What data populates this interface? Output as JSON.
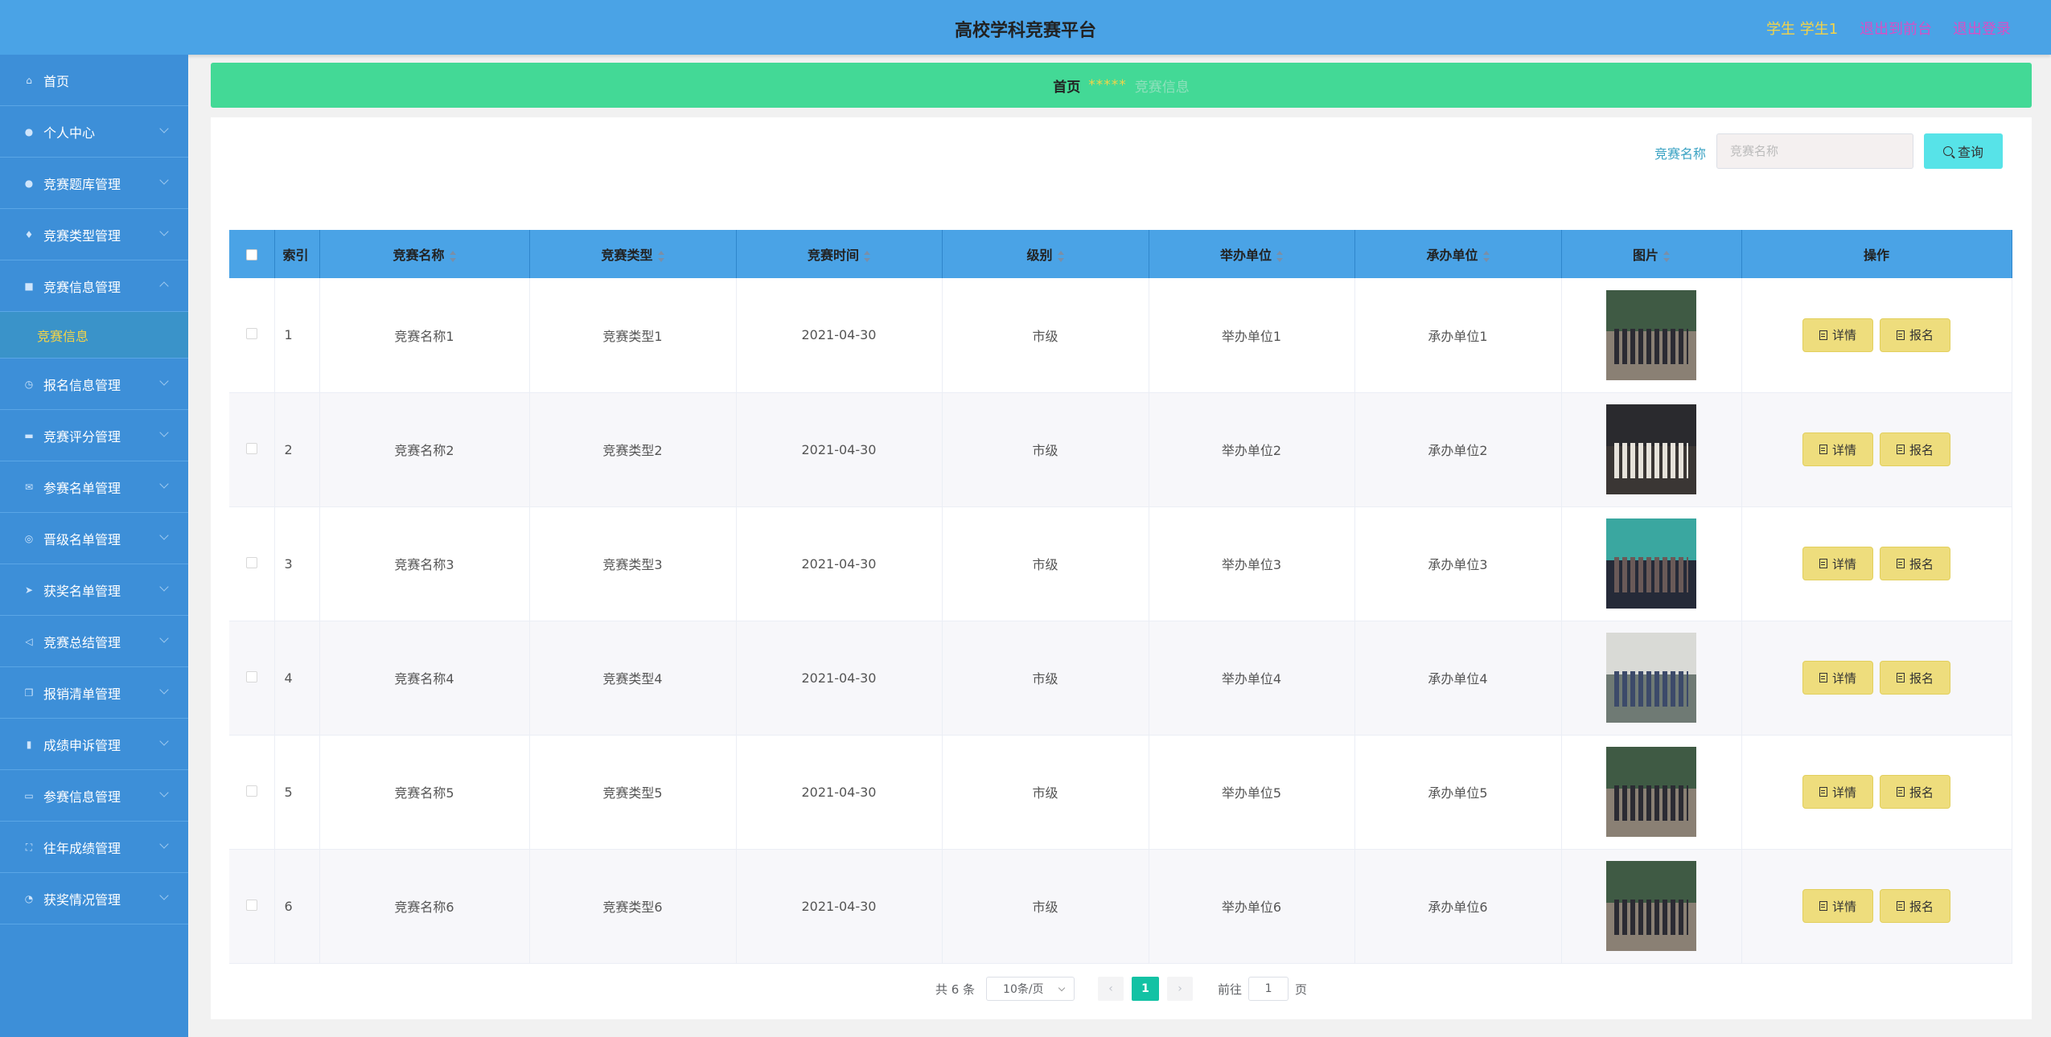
{
  "header": {
    "title": "高校学科竞赛平台",
    "user": "学生 学生1",
    "front_link": "退出到前台",
    "logout_link": "退出登录"
  },
  "sidebar": {
    "items": [
      {
        "label": "首页",
        "icon": "home-icon"
      },
      {
        "label": "个人中心",
        "icon": "user-icon"
      },
      {
        "label": "竞赛题库管理",
        "icon": "user-icon"
      },
      {
        "label": "竞赛类型管理",
        "icon": "microphone-icon"
      },
      {
        "label": "竞赛信息管理",
        "icon": "clipboard-icon",
        "expanded": true,
        "sub": "竞赛信息"
      },
      {
        "label": "报名信息管理",
        "icon": "clock-icon"
      },
      {
        "label": "竞赛评分管理",
        "icon": "monitor-icon"
      },
      {
        "label": "参赛名单管理",
        "icon": "mail-icon"
      },
      {
        "label": "晋级名单管理",
        "icon": "globe-icon"
      },
      {
        "label": "获奖名单管理",
        "icon": "send-icon"
      },
      {
        "label": "竞赛总结管理",
        "icon": "paper-plane-icon"
      },
      {
        "label": "报销清单管理",
        "icon": "copy-icon"
      },
      {
        "label": "成绩申诉管理",
        "icon": "chart-icon"
      },
      {
        "label": "参赛信息管理",
        "icon": "message-icon"
      },
      {
        "label": "往年成绩管理",
        "icon": "fullscreen-icon"
      },
      {
        "label": "获奖情况管理",
        "icon": "timer-icon"
      }
    ]
  },
  "breadcrumb": {
    "home": "首页",
    "separator": "*****",
    "current": "竞赛信息"
  },
  "search": {
    "label": "竞赛名称",
    "placeholder": "竞赛名称",
    "button": "查询"
  },
  "table": {
    "headers": [
      "索引",
      "竞赛名称",
      "竞赛类型",
      "竞赛时间",
      "级别",
      "举办单位",
      "承办单位",
      "图片",
      "操作"
    ],
    "rows": [
      {
        "index": "1",
        "name": "竞赛名称1",
        "type": "竞赛类型1",
        "time": "2021-04-30",
        "level": "市级",
        "host": "举办单位1",
        "organizer": "承办单位1",
        "photo": "outdoor-group-photo"
      },
      {
        "index": "2",
        "name": "竞赛名称2",
        "type": "竞赛类型2",
        "time": "2021-04-30",
        "level": "市级",
        "host": "举办单位2",
        "organizer": "承办单位2",
        "photo": "indoor-group-photo"
      },
      {
        "index": "3",
        "name": "竞赛名称3",
        "type": "竞赛类型3",
        "time": "2021-04-30",
        "level": "市级",
        "host": "举办单位3",
        "organizer": "承办单位3",
        "photo": "stage-group-photo"
      },
      {
        "index": "4",
        "name": "竞赛名称4",
        "type": "竞赛类型4",
        "time": "2021-04-30",
        "level": "市级",
        "host": "举办单位4",
        "organizer": "承办单位4",
        "photo": "banner-group-photo"
      },
      {
        "index": "5",
        "name": "竞赛名称5",
        "type": "竞赛类型5",
        "time": "2021-04-30",
        "level": "市级",
        "host": "举办单位5",
        "organizer": "承办单位5",
        "photo": "outdoor-group-photo"
      },
      {
        "index": "6",
        "name": "竞赛名称6",
        "type": "竞赛类型6",
        "time": "2021-04-30",
        "level": "市级",
        "host": "举办单位6",
        "organizer": "承办单位6",
        "photo": "outdoor-group-photo"
      }
    ],
    "detail_label": "详情",
    "signup_label": "报名"
  },
  "pagination": {
    "total": "共 6 条",
    "page_size": "10条/页",
    "current_page": "1",
    "goto_label": "前往",
    "goto_value": "1",
    "page_unit": "页"
  },
  "colors": {
    "header": "#4aa3e6",
    "sidebar": "#3d8fd8",
    "breadcrumb": "#43d996",
    "button": "#eedd7d",
    "search_button": "#57e3e8",
    "active_page": "#13c2a4"
  }
}
